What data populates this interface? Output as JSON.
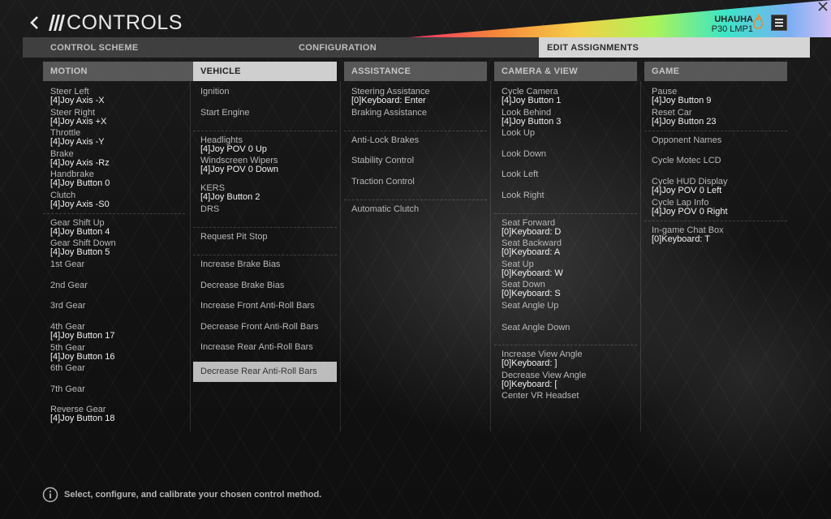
{
  "header": {
    "title": "CONTROLS",
    "profile_name": "UHAUHA",
    "profile_car": "P30 LMP1"
  },
  "tabs": [
    {
      "label": "CONTROL SCHEME"
    },
    {
      "label": "CONFIGURATION"
    },
    {
      "label": "EDIT ASSIGNMENTS"
    }
  ],
  "columns": {
    "motion": {
      "title": "MOTION",
      "items": [
        {
          "label": "Steer Left",
          "value": "[4]Joy Axis -X"
        },
        {
          "label": "Steer Right",
          "value": "[4]Joy Axis +X"
        },
        {
          "label": "Throttle",
          "value": "[4]Joy Axis -Y"
        },
        {
          "label": "Brake",
          "value": "[4]Joy Axis -Rz"
        },
        {
          "label": "Handbrake",
          "value": "[4]Joy Button 0"
        },
        {
          "label": "Clutch",
          "value": "[4]Joy Axis -S0"
        },
        {
          "label": "Gear Shift Up",
          "value": "[4]Joy Button 4"
        },
        {
          "label": "Gear Shift Down",
          "value": "[4]Joy Button 5"
        },
        {
          "label": "1st Gear",
          "value": ""
        },
        {
          "label": "2nd Gear",
          "value": ""
        },
        {
          "label": "3rd Gear",
          "value": ""
        },
        {
          "label": "4th Gear",
          "value": "[4]Joy Button 17"
        },
        {
          "label": "5th Gear",
          "value": "[4]Joy Button 16"
        },
        {
          "label": "6th Gear",
          "value": ""
        },
        {
          "label": "7th Gear",
          "value": ""
        },
        {
          "label": "Reverse Gear",
          "value": "[4]Joy Button 18"
        }
      ]
    },
    "vehicle": {
      "title": "VEHICLE",
      "items": [
        {
          "label": "Ignition",
          "value": ""
        },
        {
          "label": "Start Engine",
          "value": ""
        },
        {
          "label": "Headlights",
          "value": "[4]Joy POV 0 Up"
        },
        {
          "label": "Windscreen Wipers",
          "value": "[4]Joy POV 0 Down"
        },
        {
          "label": "KERS",
          "value": "[4]Joy Button 2"
        },
        {
          "label": "DRS",
          "value": ""
        },
        {
          "label": "Request Pit Stop",
          "value": ""
        },
        {
          "label": "Increase Brake Bias",
          "value": ""
        },
        {
          "label": "Decrease Brake Bias",
          "value": ""
        },
        {
          "label": "Increase Front Anti-Roll Bars",
          "value": ""
        },
        {
          "label": "Decrease Front Anti-Roll Bars",
          "value": ""
        },
        {
          "label": "Increase Rear Anti-Roll Bars",
          "value": ""
        },
        {
          "label": "Decrease Rear Anti-Roll Bars",
          "value": ""
        }
      ]
    },
    "assistance": {
      "title": "ASSISTANCE",
      "items": [
        {
          "label": "Steering Assistance",
          "value": "[0]Keyboard: Enter"
        },
        {
          "label": "Braking Assistance",
          "value": ""
        },
        {
          "label": "Anti-Lock Brakes",
          "value": ""
        },
        {
          "label": "Stability Control",
          "value": ""
        },
        {
          "label": "Traction Control",
          "value": ""
        },
        {
          "label": "Automatic Clutch",
          "value": ""
        }
      ]
    },
    "camera": {
      "title": "CAMERA & VIEW",
      "items": [
        {
          "label": "Cycle Camera",
          "value": "[4]Joy Button 1"
        },
        {
          "label": "Look Behind",
          "value": "[4]Joy Button 3"
        },
        {
          "label": "Look Up",
          "value": ""
        },
        {
          "label": "Look Down",
          "value": ""
        },
        {
          "label": "Look Left",
          "value": ""
        },
        {
          "label": "Look Right",
          "value": ""
        },
        {
          "label": "Seat Forward",
          "value": "[0]Keyboard: D"
        },
        {
          "label": "Seat Backward",
          "value": "[0]Keyboard: A"
        },
        {
          "label": "Seat Up",
          "value": "[0]Keyboard: W"
        },
        {
          "label": "Seat Down",
          "value": "[0]Keyboard: S"
        },
        {
          "label": "Seat Angle Up",
          "value": ""
        },
        {
          "label": "Seat Angle Down",
          "value": ""
        },
        {
          "label": "Increase View Angle",
          "value": "[0]Keyboard: ]"
        },
        {
          "label": "Decrease View Angle",
          "value": "[0]Keyboard: ["
        },
        {
          "label": "Center VR Headset",
          "value": ""
        }
      ]
    },
    "game": {
      "title": "GAME",
      "items": [
        {
          "label": "Pause",
          "value": "[4]Joy Button 9"
        },
        {
          "label": "Reset Car",
          "value": "[4]Joy Button 23"
        },
        {
          "label": "Opponent Names",
          "value": ""
        },
        {
          "label": "Cycle Motec LCD",
          "value": ""
        },
        {
          "label": "Cycle HUD Display",
          "value": "[4]Joy POV 0 Left"
        },
        {
          "label": "Cycle Lap Info",
          "value": "[4]Joy POV 0 Right"
        },
        {
          "label": "In-game Chat Box",
          "value": "[0]Keyboard: T"
        }
      ]
    }
  },
  "footer": {
    "hint": "Select, configure, and calibrate your chosen control method."
  },
  "icons": {
    "back": "chevron-left-icon",
    "logo": "project-cars-logo-icon",
    "flame": "flame-icon",
    "menu": "hamburger-menu-icon",
    "close": "close-icon",
    "info": "info-icon"
  },
  "colors": {
    "tab_active_bg": "#d5d5d5",
    "header_bg": "#6e6e6e",
    "selected_row_bg": "#bdbdbd",
    "value_text": "#f2f2f2",
    "label_text": "#b8b8b8"
  }
}
